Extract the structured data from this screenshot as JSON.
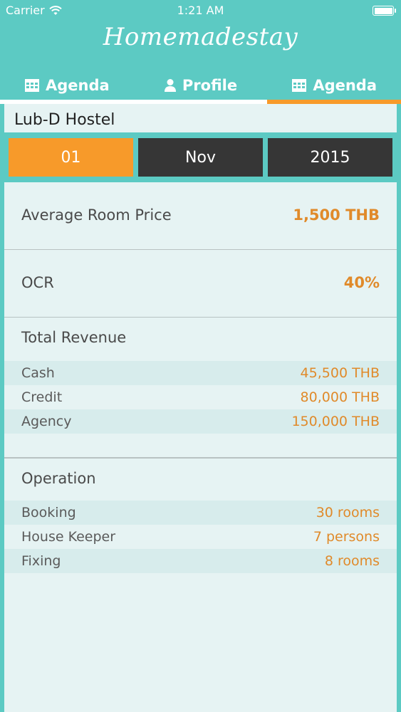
{
  "status_bar": {
    "carrier": "Carrier",
    "time": "1:21 AM",
    "battery_level": 1.0
  },
  "app": {
    "title": "Homemadestay"
  },
  "tabs": [
    {
      "label": "Agenda",
      "icon": "calendar-icon"
    },
    {
      "label": "Profile",
      "icon": "person-icon"
    },
    {
      "label": "Agenda",
      "icon": "calendar-icon"
    }
  ],
  "colors": {
    "teal": "#5ccac3",
    "orange": "#f79a2a",
    "dark": "#363636",
    "value": "#e08a2a"
  },
  "hostel": {
    "name": "Lub-D Hostel"
  },
  "date": {
    "day": "01",
    "month": "Nov",
    "year": "2015"
  },
  "stats": {
    "avg_room_price": {
      "label": "Average Room Price",
      "value": "1,500 THB"
    },
    "ocr": {
      "label": "OCR",
      "value": "40%"
    }
  },
  "revenue": {
    "title": "Total Revenue",
    "items": [
      {
        "label": "Cash",
        "value": "45,500 THB"
      },
      {
        "label": "Credit",
        "value": "80,000 THB"
      },
      {
        "label": "Agency",
        "value": "150,000 THB"
      }
    ]
  },
  "operation": {
    "title": "Operation",
    "items": [
      {
        "label": "Booking",
        "value": "30 rooms"
      },
      {
        "label": "House Keeper",
        "value": "7 persons"
      },
      {
        "label": "Fixing",
        "value": "8 rooms"
      }
    ]
  }
}
